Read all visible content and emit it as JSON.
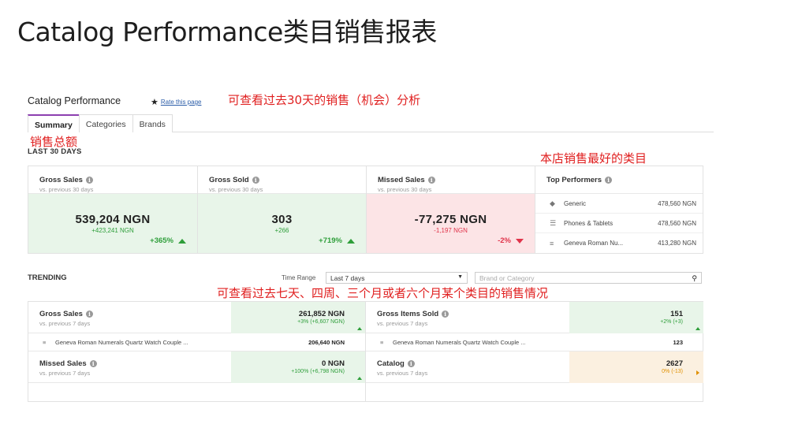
{
  "slide_title": "Catalog Performance类目销售报表",
  "header": {
    "title": "Catalog Performance",
    "rate_link": "Rate this page"
  },
  "annotations": {
    "top": "可查看过去30天的销售（机会）分析",
    "gross": "销售总额",
    "best": "本店销售最好的类目",
    "trend": "可查看过去七天、四周、三个月或者六个月某个类目的销售情况"
  },
  "tabs": [
    {
      "label": "Summary",
      "active": true
    },
    {
      "label": "Categories",
      "active": false
    },
    {
      "label": "Brands",
      "active": false
    }
  ],
  "last30": {
    "label": "LAST 30 DAYS",
    "cards": [
      {
        "name": "Gross Sales",
        "sub": "vs. previous 30 days",
        "value": "539,204 NGN",
        "delta": "+423,241 NGN",
        "pct": "+365%",
        "trend": "up"
      },
      {
        "name": "Gross Sold",
        "sub": "vs. previous 30 days",
        "value": "303",
        "delta": "+266",
        "pct": "+719%",
        "trend": "up"
      },
      {
        "name": "Missed Sales",
        "sub": "vs. previous 30 days",
        "value": "-77,275 NGN",
        "delta": "-1,197 NGN",
        "pct": "-2%",
        "trend": "down"
      }
    ],
    "top_performers": {
      "title": "Top Performers",
      "items": [
        {
          "icon": "tag-icon",
          "name": "Generic",
          "value": "478,560 NGN"
        },
        {
          "icon": "list-icon",
          "name": "Phones & Tablets",
          "value": "478,560 NGN"
        },
        {
          "icon": "stack-icon",
          "name": "Geneva Roman Nu...",
          "value": "413,280 NGN"
        }
      ]
    }
  },
  "trending": {
    "label": "TRENDING",
    "time_range_label": "Time Range",
    "time_range_value": "Last 7 days",
    "search_placeholder": "Brand or Category",
    "left": {
      "gross_sales": {
        "name": "Gross Sales",
        "sub": "vs. previous 7 days",
        "value": "261,852 NGN",
        "delta": "+3% (+6,607 NGN)"
      },
      "row": {
        "name": "Geneva Roman Numerals Quartz Watch Couple ...",
        "value": "206,640 NGN"
      },
      "missed_sales": {
        "name": "Missed Sales",
        "sub": "vs. previous 7 days",
        "value": "0 NGN",
        "delta": "+100% (+6,798 NGN)"
      }
    },
    "right": {
      "gross_items": {
        "name": "Gross Items Sold",
        "sub": "vs. previous 7 days",
        "value": "151",
        "delta": "+2% (+3)"
      },
      "row": {
        "name": "Geneva Roman Numerals Quartz Watch Couple ...",
        "value": "123"
      },
      "catalog": {
        "name": "Catalog",
        "sub": "vs. previous 7 days",
        "value": "2627",
        "delta": "0% (-13)"
      }
    }
  },
  "colors": {
    "accent_purple": "#8c3fb0",
    "positive": "#2e9e3a",
    "negative": "#e0334a",
    "annotation_red": "#e02020"
  }
}
